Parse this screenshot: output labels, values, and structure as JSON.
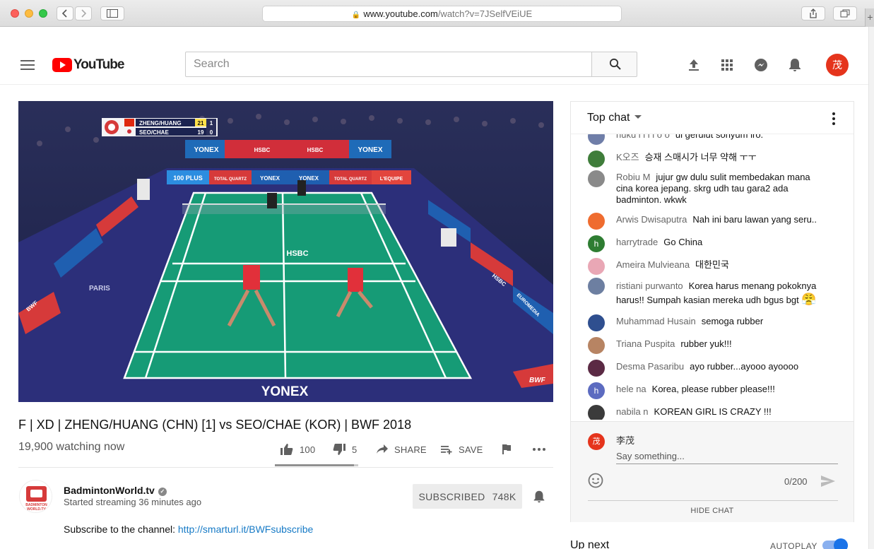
{
  "browser": {
    "url_host": "www.youtube.com",
    "url_path": "/watch?v=7JSelfVEiUE",
    "new_tab": "+"
  },
  "header": {
    "logo_text": "YouTube",
    "search_placeholder": "Search",
    "avatar_initial": "茂",
    "icons": [
      "menu-icon",
      "upload-icon",
      "apps-icon",
      "messages-icon",
      "notifications-icon",
      "search-icon"
    ]
  },
  "video": {
    "score": {
      "team1": "ZHENG/HUANG",
      "team1_game": "21",
      "team1_set": "1",
      "team2": "SEO/CHAE",
      "team2_game": "19",
      "team2_set": "0"
    },
    "court_brand": "YONEX",
    "banner_text": [
      "YONEX",
      "HSBC",
      "HSBC",
      "YONEX",
      "100 PLUS",
      "TOTAL QUARTZ",
      "YONEX",
      "YONEX",
      "TOTAL QUARTZ",
      "L'EQUIPE"
    ],
    "side_text": [
      "PARIS",
      "HSBC",
      "EUROMEDIA",
      "BWF"
    ],
    "net_brand": "HSBC",
    "bwf_badge": "BWF"
  },
  "meta": {
    "title": "F | XD | ZHENG/HUANG (CHN) [1] vs SEO/CHAE (KOR) | BWF 2018",
    "watching": "19,900 watching now",
    "likes": "100",
    "dislikes": "5",
    "share_label": "SHARE",
    "save_label": "SAVE",
    "like_ratio": 0.95
  },
  "channel": {
    "name": "BadmintonWorld.tv",
    "started": "Started streaming 36 minutes ago",
    "subscribe_label": "SUBSCRIBED",
    "subscriber_count": "748K",
    "desc_prefix": "Subscribe to the channel: ",
    "desc_link": "http://smarturl.it/BWFsubscribe",
    "logo_text": [
      "BADMINTON",
      "WORLD.TV"
    ]
  },
  "chat": {
    "mode_label": "Top chat",
    "messages": [
      {
        "author": "nuku i i i i o o",
        "text": "ul gerulut sonyum iro.",
        "avatar_color": "#6f7ea8",
        "initial": ""
      },
      {
        "author": "K오즈",
        "text": "승재 스매시가 너무 약해 ㅜㅜ",
        "avatar_color": "#3f7d3a",
        "initial": ""
      },
      {
        "author": "Robiu M",
        "text": "jujur gw dulu sulit membedakan mana cina korea jepang. skrg udh tau gara2 ada badminton. wkwk",
        "avatar_color": "#8a8a8a",
        "initial": ""
      },
      {
        "author": "Arwis Dwisaputra",
        "text": "Nah ini baru lawan yang seru..",
        "avatar_color": "#ef6c2f",
        "initial": ""
      },
      {
        "author": "harrytrade",
        "text": "Go China",
        "avatar_color": "#2e7d32",
        "initial": "h"
      },
      {
        "author": "Ameira Mulvieana",
        "text": "대한민국",
        "avatar_color": "#e9a7b5",
        "initial": ""
      },
      {
        "author": "ristiani purwanto",
        "text": "Korea harus menang pokoknya harus!! Sumpah kasian mereka udh bgus bgt",
        "emoji": "😤",
        "avatar_color": "#6d7fa1",
        "initial": ""
      },
      {
        "author": "Muhammad Husain",
        "text": "semoga rubber",
        "avatar_color": "#2f4f8f",
        "initial": ""
      },
      {
        "author": "Triana Puspita",
        "text": "rubber yuk!!!",
        "avatar_color": "#b78463",
        "initial": ""
      },
      {
        "author": "Desma Pasaribu",
        "text": "ayo rubber...ayooo ayoooo",
        "avatar_color": "#5b2a44",
        "initial": ""
      },
      {
        "author": "hele na",
        "text": "Korea, please rubber please!!!",
        "avatar_color": "#5c6bc0",
        "initial": "h"
      },
      {
        "author": "nabila n",
        "text": "KOREAN GIRL IS CRAZY !!!",
        "avatar_color": "#3b3b3b",
        "initial": ""
      }
    ],
    "composer": {
      "user_initial": "茂",
      "user_name": "李茂",
      "placeholder": "Say something...",
      "counter": "0/200",
      "hide_label": "HIDE CHAT"
    }
  },
  "sidebar": {
    "up_next": "Up next",
    "autoplay": "AUTOPLAY"
  },
  "colors": {
    "brand_red": "#ff0000",
    "link_blue": "#167ac6",
    "toggle_blue": "#1a73e8"
  }
}
